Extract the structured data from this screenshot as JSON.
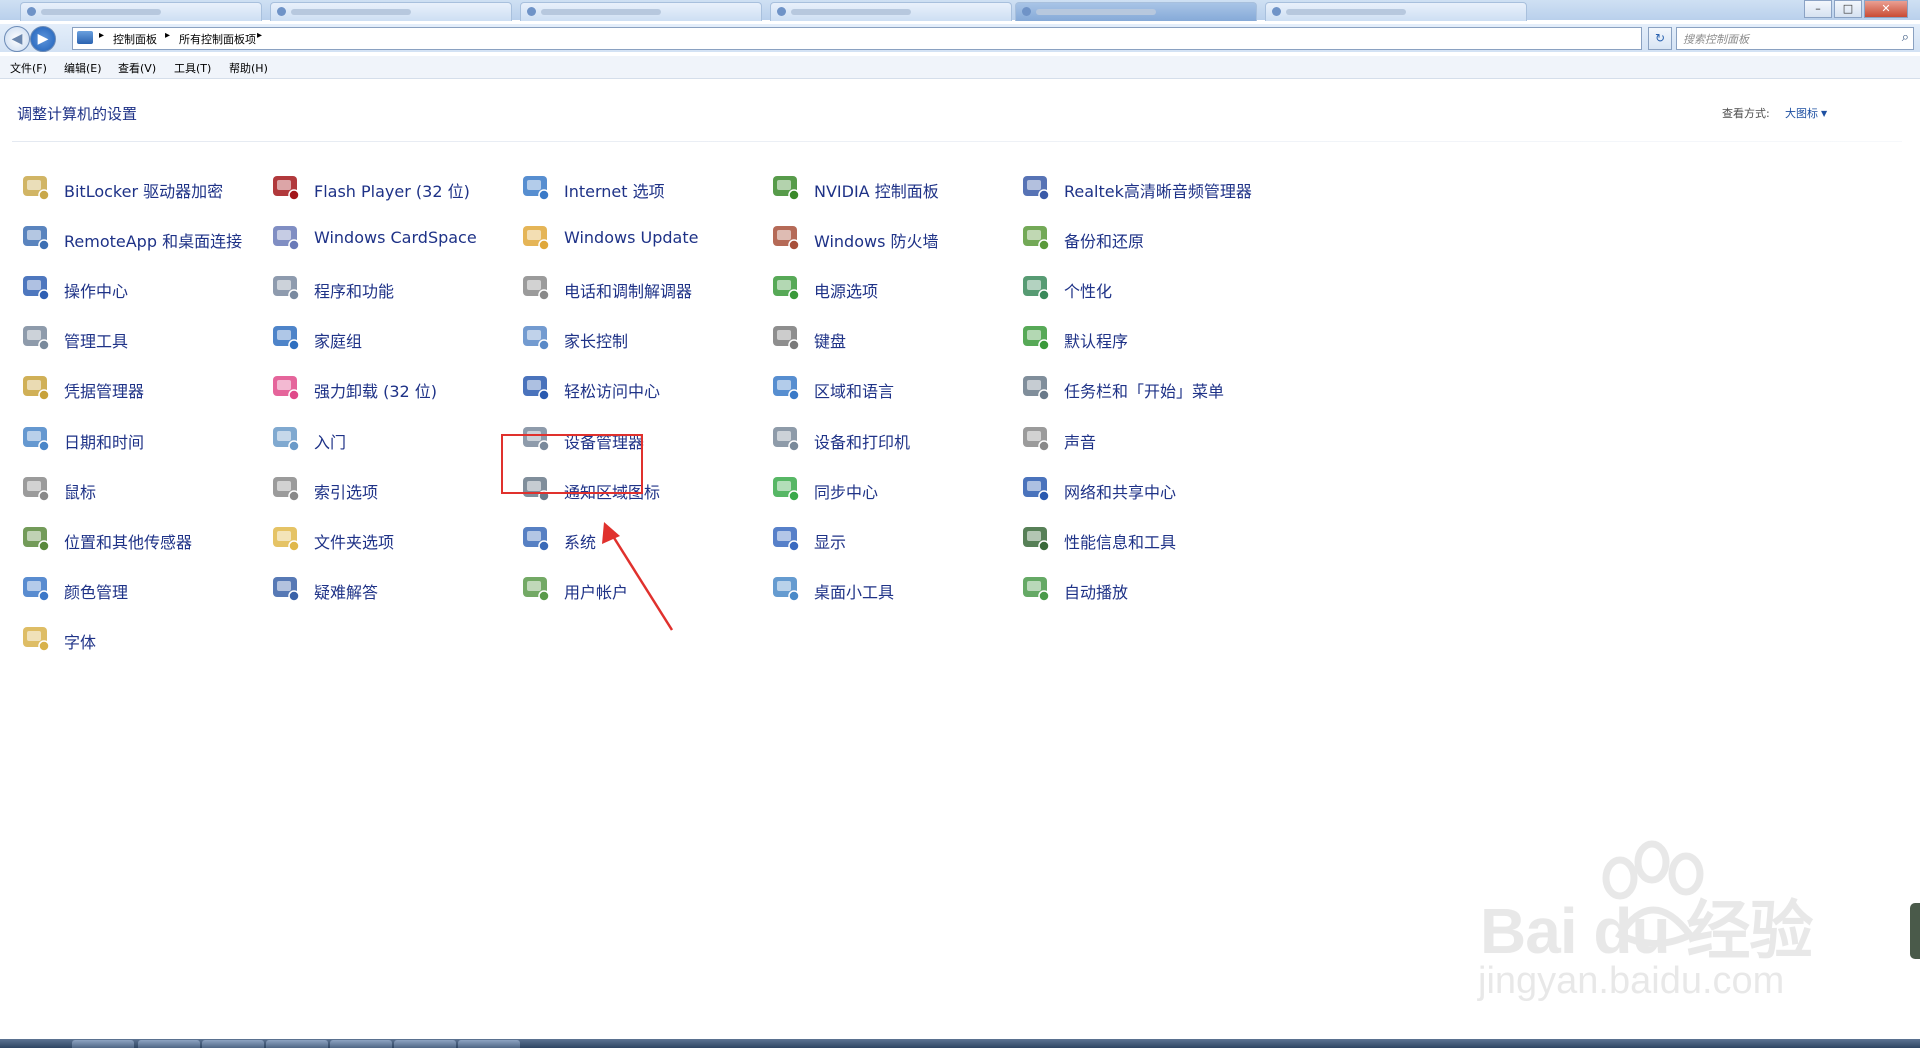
{
  "window": {
    "minimize_glyph": "–",
    "maximize_glyph": "□",
    "close_glyph": "✕"
  },
  "address_bar": {
    "breadcrumbs": [
      "控制面板",
      "所有控制面板项"
    ],
    "separator": "▸",
    "search_placeholder": "搜索控制面板",
    "search_icon": "magnifier-icon",
    "back_glyph": "◀",
    "forward_glyph": "▶",
    "refresh_glyph": "↻"
  },
  "menu_bar": [
    "文件(F)",
    "编辑(E)",
    "查看(V)",
    "工具(T)",
    "帮助(H)"
  ],
  "content": {
    "heading": "调整计算机的设置",
    "view_by_label": "查看方式:",
    "view_by_value": "大图标",
    "view_by_caret": "▼"
  },
  "columns": [
    [
      {
        "label": "BitLocker 驱动器加密",
        "icon": "bitlocker-icon",
        "color": "#c9a84a"
      },
      {
        "label": "RemoteApp 和桌面连接",
        "icon": "remoteapp-icon",
        "color": "#3d6fb3"
      },
      {
        "label": "操作中心",
        "icon": "action-center-flag-icon",
        "color": "#2f5fb3"
      },
      {
        "label": "管理工具",
        "icon": "admin-tools-icon",
        "color": "#7a8a9c"
      },
      {
        "label": "凭据管理器",
        "icon": "credential-manager-icon",
        "color": "#c8a23a"
      },
      {
        "label": "日期和时间",
        "icon": "date-time-icon",
        "color": "#4a86c8"
      },
      {
        "label": "鼠标",
        "icon": "mouse-icon",
        "color": "#8a8a8a"
      },
      {
        "label": "位置和其他传感器",
        "icon": "location-sensors-icon",
        "color": "#5a8a3c"
      },
      {
        "label": "颜色管理",
        "icon": "color-management-icon",
        "color": "#3c78c8"
      },
      {
        "label": "字体",
        "icon": "fonts-icon",
        "color": "#d8b24a"
      }
    ],
    [
      {
        "label": "Flash Player (32 位)",
        "icon": "flash-player-icon",
        "color": "#a3161a"
      },
      {
        "label": "Windows CardSpace",
        "icon": "cardspace-icon",
        "color": "#6a7ab8"
      },
      {
        "label": "程序和功能",
        "icon": "programs-features-icon",
        "color": "#7a8aa0"
      },
      {
        "label": "家庭组",
        "icon": "homegroup-icon",
        "color": "#2f6fc0"
      },
      {
        "label": "强力卸载 (32 位)",
        "icon": "uninstall-tool-icon",
        "color": "#e04a8a"
      },
      {
        "label": "入门",
        "icon": "getting-started-icon",
        "color": "#6a9ac8"
      },
      {
        "label": "索引选项",
        "icon": "indexing-options-icon",
        "color": "#8a8a8a"
      },
      {
        "label": "文件夹选项",
        "icon": "folder-options-icon",
        "color": "#e0b84a"
      },
      {
        "label": "疑难解答",
        "icon": "troubleshooting-icon",
        "color": "#3a62a8"
      }
    ],
    [
      {
        "label": "Internet 选项",
        "icon": "internet-options-icon",
        "color": "#3a7ac8"
      },
      {
        "label": "Windows Update",
        "icon": "windows-update-icon",
        "color": "#e0a83a"
      },
      {
        "label": "电话和调制解调器",
        "icon": "phone-modem-icon",
        "color": "#8a8a8a"
      },
      {
        "label": "家长控制",
        "icon": "parental-controls-icon",
        "color": "#5a8ac8"
      },
      {
        "label": "轻松访问中心",
        "icon": "ease-of-access-icon",
        "color": "#2a5ab0"
      },
      {
        "label": "设备管理器",
        "icon": "device-manager-icon",
        "color": "#7a8a9c"
      },
      {
        "label": "通知区域图标",
        "icon": "notification-area-icon",
        "color": "#6a7a8a"
      },
      {
        "label": "系统",
        "icon": "system-icon",
        "color": "#3a6ab8"
      },
      {
        "label": "用户帐户",
        "icon": "user-accounts-icon",
        "color": "#5a9a4a"
      }
    ],
    [
      {
        "label": "NVIDIA 控制面板",
        "icon": "nvidia-icon",
        "color": "#3a8a2a"
      },
      {
        "label": "Windows 防火墙",
        "icon": "firewall-icon",
        "color": "#a8503a"
      },
      {
        "label": "电源选项",
        "icon": "power-options-icon",
        "color": "#3a9a3a"
      },
      {
        "label": "键盘",
        "icon": "keyboard-icon",
        "color": "#7a7a7a"
      },
      {
        "label": "区域和语言",
        "icon": "region-language-icon",
        "color": "#3a7ac8"
      },
      {
        "label": "设备和打印机",
        "icon": "devices-printers-icon",
        "color": "#7a8a9a"
      },
      {
        "label": "同步中心",
        "icon": "sync-center-icon",
        "color": "#3aaa4a"
      },
      {
        "label": "显示",
        "icon": "display-icon",
        "color": "#3a6ac0"
      },
      {
        "label": "桌面小工具",
        "icon": "desktop-gadgets-icon",
        "color": "#4a8ac8"
      }
    ],
    [
      {
        "label": "Realtek高清晰音频管理器",
        "icon": "realtek-audio-icon",
        "color": "#3a5aa8"
      },
      {
        "label": "备份和还原",
        "icon": "backup-restore-icon",
        "color": "#5a9a3a"
      },
      {
        "label": "个性化",
        "icon": "personalization-icon",
        "color": "#3a8a5a"
      },
      {
        "label": "默认程序",
        "icon": "default-programs-icon",
        "color": "#3a9a3a"
      },
      {
        "label": "任务栏和「开始」菜单",
        "icon": "taskbar-start-menu-icon",
        "color": "#6a7a8a"
      },
      {
        "label": "声音",
        "icon": "sound-icon",
        "color": "#8a8a8a"
      },
      {
        "label": "网络和共享中心",
        "icon": "network-sharing-icon",
        "color": "#2a5ab0"
      },
      {
        "label": "性能信息和工具",
        "icon": "performance-tools-icon",
        "color": "#3a6a3a"
      },
      {
        "label": "自动播放",
        "icon": "autoplay-icon",
        "color": "#4a9a4a"
      }
    ]
  ],
  "highlight": {
    "target": "系统",
    "color": "#e0312d"
  },
  "watermark": {
    "brand": "Bai  du 经验",
    "url": "jingyan.baidu.com"
  }
}
